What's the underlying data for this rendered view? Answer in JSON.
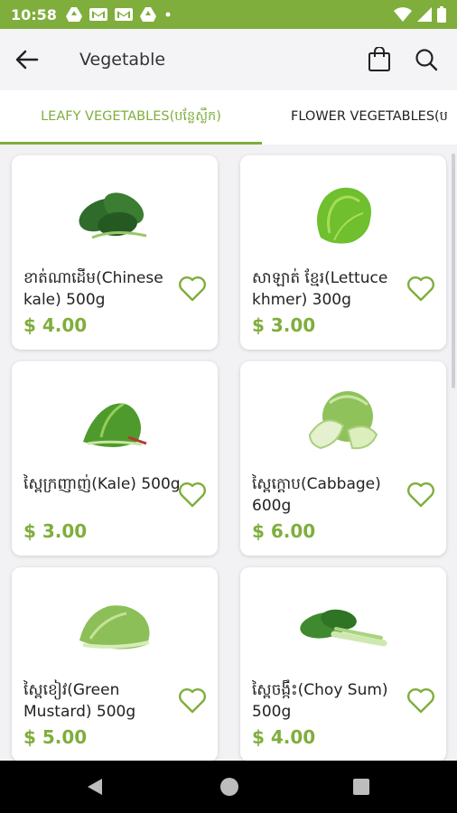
{
  "status_bar": {
    "time": "10:58"
  },
  "header": {
    "title": "Vegetable"
  },
  "tabs": [
    {
      "label": "LEAFY VEGETABLES(បន្លែស្លឹក)"
    },
    {
      "label": "FLOWER VEGETABLES(ប"
    }
  ],
  "products": [
    {
      "name": "ខាត់ណាដើម(Chinese kale) 500g",
      "price": "$ 4.00",
      "icon": "chinese-kale-image"
    },
    {
      "name": "សាឡាត់ ខ្មែរ(Lettuce khmer) 300g",
      "price": "$ 3.00",
      "icon": "lettuce-image"
    },
    {
      "name": "ស្ពៃក្រញាញ់(Kale) 500g",
      "price": "$ 3.00",
      "icon": "kale-image"
    },
    {
      "name": "ស្ពៃក្តោប(Cabbage) 600g",
      "price": "$ 6.00",
      "icon": "cabbage-image"
    },
    {
      "name": "ស្ពៃខៀវ(Green Mustard) 500g",
      "price": "$ 5.00",
      "icon": "green-mustard-image"
    },
    {
      "name": "ស្ពៃចង្កឹះ(Choy Sum) 500g",
      "price": "$ 4.00",
      "icon": "choy-sum-image"
    }
  ],
  "colors": {
    "accent": "#7fae3c",
    "background": "#f2f2f4",
    "card": "#ffffff"
  }
}
